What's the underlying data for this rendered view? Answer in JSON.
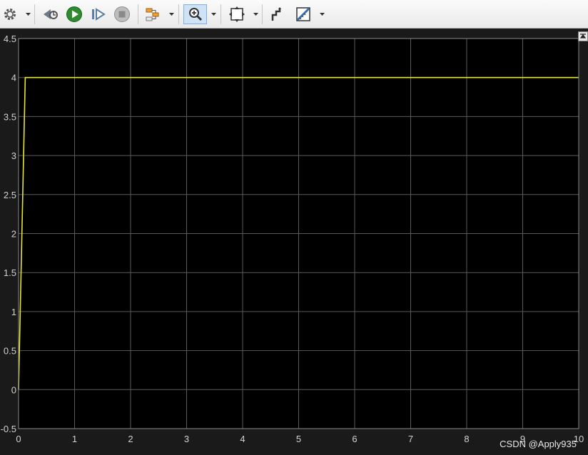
{
  "toolbar": {
    "icons": [
      "gear-icon",
      "step-back-icon",
      "run-icon",
      "step-forward-icon",
      "stop-icon",
      "signal-selector-icon",
      "zoom-icon",
      "autoscale-icon",
      "style-icon",
      "cursor-measure-icon"
    ],
    "accent": "#2e8b2e"
  },
  "watermark": "CSDN @Apply935",
  "chart_data": {
    "type": "line",
    "background": "#000000",
    "grid": true,
    "grid_color": "#5a5a5a",
    "xlim": [
      0,
      10
    ],
    "ylim": [
      -0.5,
      4.5
    ],
    "xticks": [
      "0",
      "1",
      "2",
      "3",
      "4",
      "5",
      "6",
      "7",
      "8",
      "9",
      "10"
    ],
    "yticks": [
      "-0.5",
      "0",
      "0.5",
      "1",
      "1.5",
      "2",
      "2.5",
      "3",
      "3.5",
      "4",
      "4.5"
    ],
    "series": [
      {
        "color": "#e6e632",
        "x": [
          0,
          0.12,
          10
        ],
        "y": [
          0,
          4,
          4
        ]
      }
    ]
  }
}
